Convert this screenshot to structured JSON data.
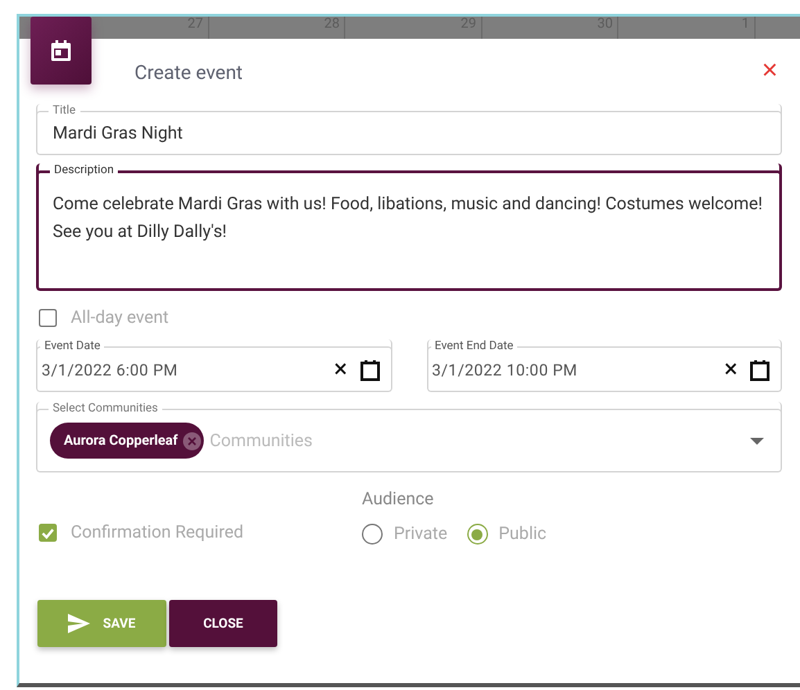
{
  "calendar_days": [
    "27",
    "28",
    "29",
    "30",
    "1"
  ],
  "dialog": {
    "title": "Create event",
    "close_glyph": "×"
  },
  "title_field": {
    "label": "Title",
    "value": "Mardi Gras Night"
  },
  "description_field": {
    "label": "Description",
    "value": "Come celebrate Mardi Gras with us! Food, libations, music and dancing! Costumes welcome! See you at Dilly Dally's!",
    "focused": true
  },
  "all_day": {
    "label": "All-day event",
    "checked": false
  },
  "dates": [
    {
      "label": "Event Date",
      "value": "3/1/2022 6:00 PM",
      "clear_glyph": "×"
    },
    {
      "label": "Event End Date",
      "value": "3/1/2022 10:00 PM",
      "clear_glyph": "×"
    }
  ],
  "communities": {
    "label": "Select Communities",
    "chips": [
      "Aurora Copperleaf"
    ],
    "placeholder": "Communities"
  },
  "confirmation": {
    "label": "Confirmation Required",
    "checked": true
  },
  "audience": {
    "label": "Audience",
    "options": [
      {
        "label": "Private",
        "selected": false
      },
      {
        "label": "Public",
        "selected": true
      }
    ]
  },
  "buttons": [
    {
      "kind": "save",
      "label": "SAVE"
    },
    {
      "kind": "close",
      "label": "CLOSE"
    }
  ]
}
